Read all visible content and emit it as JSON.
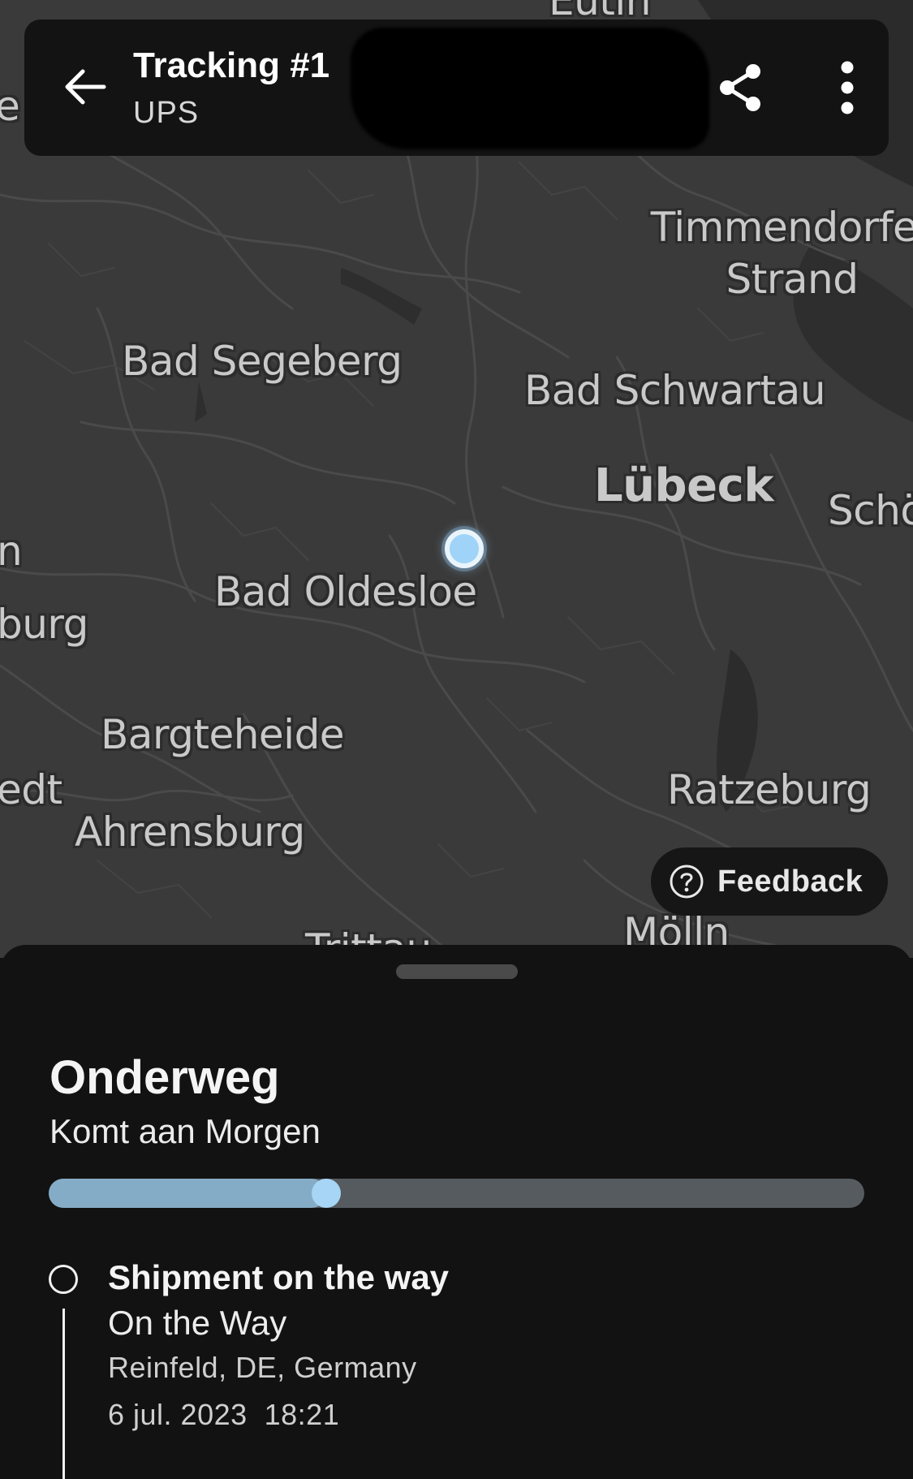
{
  "header": {
    "title": "Tracking #1",
    "carrier": "UPS",
    "back_icon": "arrow-left-icon",
    "share_icon": "share-icon",
    "more_icon": "more-vertical-icon"
  },
  "map": {
    "cities": [
      {
        "id": "eutin",
        "label": "Eutin"
      },
      {
        "id": "timmendorfer-strand",
        "label": "Timmendorfer Strand"
      },
      {
        "id": "bad-segeberg",
        "label": "Bad Segeberg"
      },
      {
        "id": "bad-schwartau",
        "label": "Bad Schwartau"
      },
      {
        "id": "lubeck",
        "label": "Lübeck"
      },
      {
        "id": "scho",
        "label": "Schö"
      },
      {
        "id": "bad-oldesloe",
        "label": "Bad Oldesloe"
      },
      {
        "id": "burg",
        "label": "burg"
      },
      {
        "id": "n",
        "label": "n"
      },
      {
        "id": "e",
        "label": "e"
      },
      {
        "id": "bargteheide",
        "label": "Bargteheide"
      },
      {
        "id": "edt",
        "label": "edt"
      },
      {
        "id": "ratzeburg",
        "label": "Ratzeburg"
      },
      {
        "id": "ahrensburg",
        "label": "Ahrensburg"
      },
      {
        "id": "trittau",
        "label": "Trittau"
      },
      {
        "id": "molln",
        "label": "Mölln"
      }
    ],
    "feedback_label": "Feedback",
    "feedback_icon": "help-circle-icon"
  },
  "sheet": {
    "status": "Onderweg",
    "eta": "Komt aan Morgen",
    "progress": 0.34,
    "colors": {
      "progress_fill": "#85acc7",
      "progress_knob": "#a6d5f5",
      "track": "#565b60",
      "background": "#121212"
    },
    "events": [
      {
        "title": "Shipment on the way",
        "status": "On the Way",
        "location": "Reinfeld, DE, Germany",
        "time": "6 jul. 2023  18:21"
      }
    ]
  }
}
